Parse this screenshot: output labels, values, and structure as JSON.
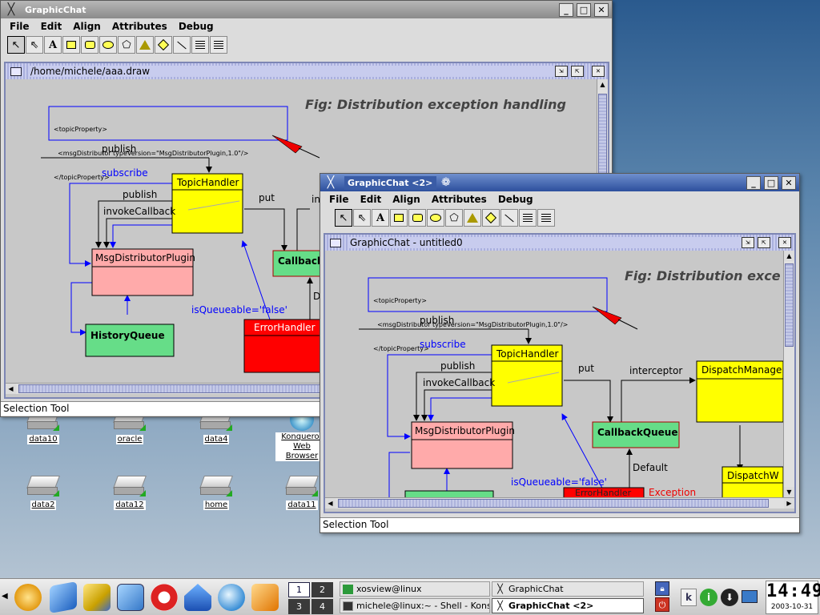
{
  "desktop": {
    "icons": [
      {
        "label": "data10"
      },
      {
        "label": "oracle"
      },
      {
        "label": "data4"
      },
      {
        "label": "Konqueror Web Browser"
      },
      {
        "label": "data2"
      },
      {
        "label": "data12"
      },
      {
        "label": "home"
      },
      {
        "label": "data11"
      }
    ]
  },
  "window1": {
    "title": "GraphicChat",
    "menu": [
      "File",
      "Edit",
      "Align",
      "Attributes",
      "Debug"
    ],
    "inner_title": "/home/michele/aaa.draw",
    "status": "Selection Tool",
    "diagram": {
      "fig_title": "Fig: Distribution exception handling",
      "xml_note": [
        "<topicProperty>",
        "  <msgDistributor typeVersion=\"MsgDistributorPlugin,1.0\"/>",
        "</topicProperty>"
      ],
      "publish": "publish",
      "subscribe": "subscribe",
      "topic_handler": "TopicHandler",
      "publish2": "publish",
      "invoke_callback": "invokeCallback",
      "put": "put",
      "interceptor_cut": "int",
      "msg_plugin": "MsgDistributorPlugin",
      "callback_cut": "Callback",
      "history_queue": "HistoryQueue",
      "is_queueable": "isQueueable='false'",
      "error_handler": "ErrorHandler",
      "default_cut": "D"
    }
  },
  "window2": {
    "title": "GraphicChat <2>",
    "menu": [
      "File",
      "Edit",
      "Align",
      "Attributes",
      "Debug"
    ],
    "inner_title": "GraphicChat - untitled0",
    "status": "Selection Tool",
    "diagram": {
      "fig_title": "Fig: Distribution exce",
      "xml_note": [
        "<topicProperty>",
        "  <msgDistributor typeVersion=\"MsgDistributorPlugin,1.0\"/>",
        "</topicProperty>"
      ],
      "publish": "publish",
      "subscribe": "subscribe",
      "topic_handler": "TopicHandler",
      "publish2": "publish",
      "invoke_callback": "invokeCallback",
      "put": "put",
      "interceptor": "interceptor",
      "dispatch_manager": "DispatchManager",
      "msg_plugin": "MsgDistributorPlugin",
      "callback_queue": "CallbackQueue",
      "default": "Default",
      "is_queueable": "isQueueable='false'",
      "error_handler": "ErrorHandler",
      "exception": "Exception",
      "dispatch_w": "DispatchW"
    }
  },
  "taskbar": {
    "pager": [
      "1",
      "2",
      "3",
      "4"
    ],
    "tasks": [
      {
        "label": "xosview@linux"
      },
      {
        "label": "GraphicChat"
      },
      {
        "label": "michele@linux:~ - Shell - Konsole"
      },
      {
        "label": "GraphicChat <2>"
      }
    ],
    "clock_time": "14:49",
    "clock_date": "2003-10-31"
  },
  "colors": {
    "yellow_box": "#ffff00",
    "pink_box": "#ffaaaa",
    "green_box": "#66dd88",
    "red_box": "#ff0000",
    "blue_line": "#0000ff"
  }
}
